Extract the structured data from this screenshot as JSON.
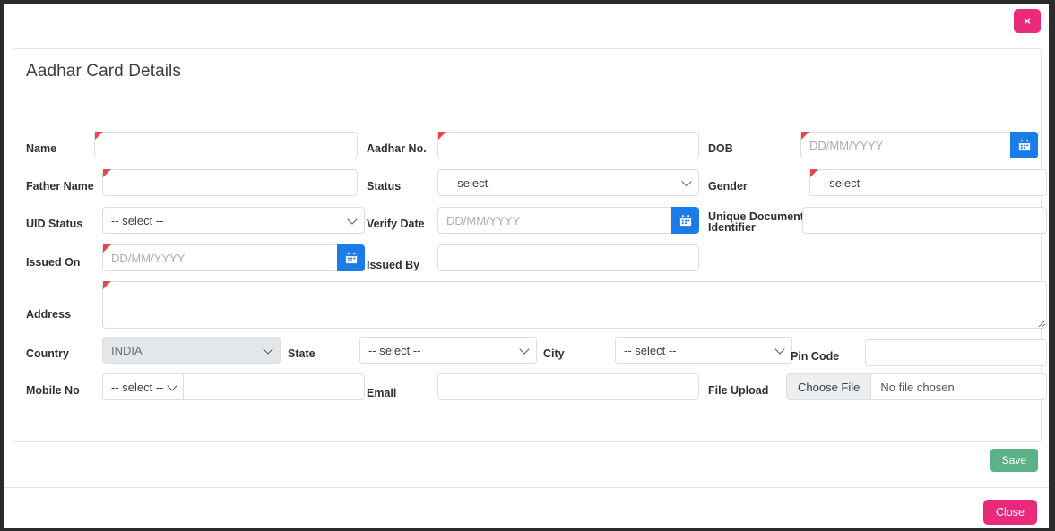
{
  "modal": {
    "close_icon_label": "×",
    "title": "Aadhar Card Details",
    "save_label": "Save",
    "close_label": "Close"
  },
  "placeholders": {
    "date": "DD/MM/YYYY",
    "select": "-- select --",
    "empty": ""
  },
  "fields": {
    "name": {
      "label": "Name",
      "value": "",
      "required": true
    },
    "aadhar_no": {
      "label": "Aadhar No.",
      "value": "",
      "required": true
    },
    "dob": {
      "label": "DOB",
      "value": "",
      "placeholder": "DD/MM/YYYY",
      "required": true
    },
    "father_name": {
      "label": "Father Name",
      "value": "",
      "required": true
    },
    "status": {
      "label": "Status",
      "value": "-- select --",
      "required": false
    },
    "gender": {
      "label": "Gender",
      "value": "-- select --",
      "required": true
    },
    "uid_status": {
      "label": "UID Status",
      "value": "-- select --",
      "required": false
    },
    "verify_date": {
      "label": "Verify Date",
      "value": "",
      "placeholder": "DD/MM/YYYY",
      "required": false
    },
    "unique_document_identifier": {
      "label": "Unique Document\nIdentifier",
      "label_line1": "Unique Document",
      "label_line2": "Identifier",
      "value": "",
      "required": false
    },
    "issued_on": {
      "label": "Issued On",
      "value": "",
      "placeholder": "DD/MM/YYYY",
      "required": true
    },
    "issued_by": {
      "label": "Issued By",
      "value": "",
      "required": false
    },
    "address": {
      "label": "Address",
      "value": "",
      "required": true
    },
    "country": {
      "label": "Country",
      "value": "INDIA",
      "disabled": true,
      "required": false
    },
    "state": {
      "label": "State",
      "value": "-- select --",
      "required": false
    },
    "city": {
      "label": "City",
      "value": "-- select --",
      "required": false
    },
    "pin_code": {
      "label": "Pin Code",
      "value": "",
      "required": false
    },
    "mobile_no": {
      "label": "Mobile No",
      "code_value": "-- select --",
      "value": "",
      "required": false
    },
    "email": {
      "label": "Email",
      "value": "",
      "required": false
    },
    "file_upload": {
      "label": "File Upload",
      "choose_label": "Choose File",
      "file_name": "No file chosen"
    }
  },
  "colors": {
    "accent_pink": "#ec2a7c",
    "save_green": "#5cb287",
    "calendar_blue": "#1a7ce8",
    "required_red": "#e04a4a"
  }
}
